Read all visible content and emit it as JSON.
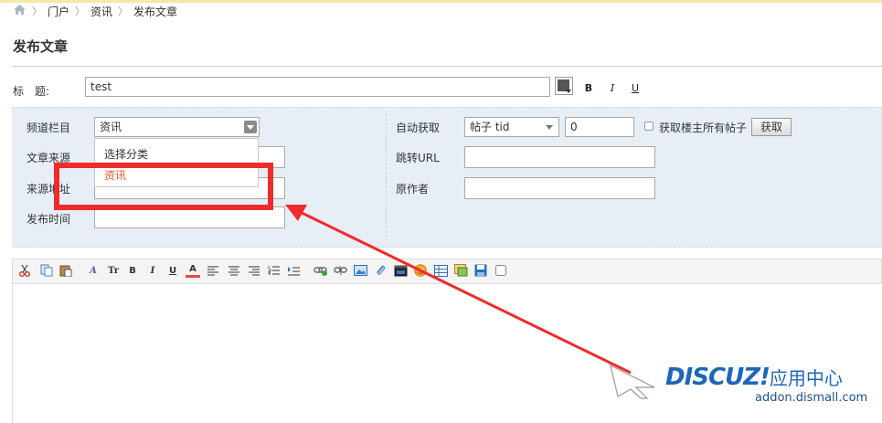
{
  "breadcrumb": {
    "items": [
      "门户",
      "资讯",
      "发布文章"
    ]
  },
  "page_title": "发布文章",
  "title_row": {
    "label": "标　题:",
    "value": "test",
    "bold": "B",
    "italic": "I",
    "underline": "U"
  },
  "left_fields": {
    "channel_label": "频道栏目",
    "channel_value": "资讯",
    "source_label": "文章来源",
    "source_url_label": "来源地址",
    "publish_time_label": "发布时间"
  },
  "dropdown": {
    "options": [
      "选择分类",
      "资讯"
    ]
  },
  "right_fields": {
    "auto_fetch_label": "自动获取",
    "fetch_type_value": "帖子 tid",
    "tid_value": "0",
    "fetch_all_label": "获取楼主所有帖子",
    "fetch_button": "获取",
    "jump_url_label": "跳转URL",
    "author_label": "原作者"
  },
  "toolbar": {
    "icons": [
      "cut-icon",
      "copy-icon",
      "paste-icon",
      "font-family-icon",
      "font-size-icon",
      "bold-icon",
      "italic-icon",
      "underline-icon",
      "font-color-icon",
      "align-left-icon",
      "align-center-icon",
      "align-right-icon",
      "ordered-list-icon",
      "indent-icon",
      "link-icon",
      "unlink-icon",
      "image-icon",
      "attach-icon",
      "video-icon",
      "emoticon-icon",
      "table-icon",
      "insert-image-icon",
      "save-icon",
      "checkbox-icon"
    ],
    "glyphs": {
      "font_family": "A",
      "font_size": "Tr",
      "bold": "B",
      "italic": "I",
      "underline": "U",
      "font_color": "A"
    }
  },
  "watermark": {
    "brand": "DISCUZ!",
    "cn": "应用中心",
    "url": "addon.dismall.com"
  },
  "colors": {
    "panel_bg": "#e7eef6",
    "highlight_red": "#ef2b2b",
    "brand_blue": "#1f66b8",
    "selected_option": "#e05a2b"
  }
}
